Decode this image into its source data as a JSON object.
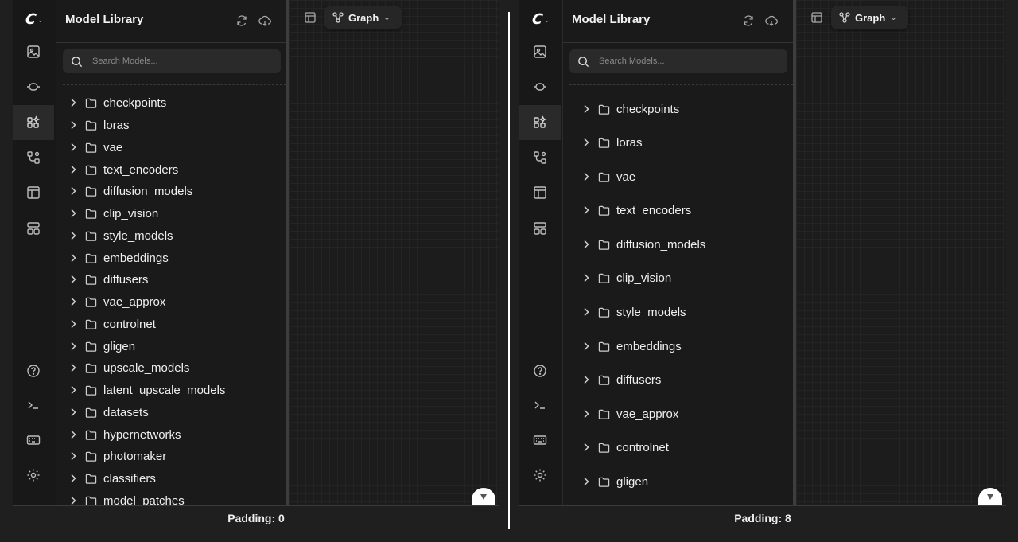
{
  "sidebar": {
    "title": "Model Library",
    "search_placeholder": "Search Models...",
    "folders": [
      "checkpoints",
      "loras",
      "vae",
      "text_encoders",
      "diffusion_models",
      "clip_vision",
      "style_models",
      "embeddings",
      "diffusers",
      "vae_approx",
      "controlnet",
      "gligen",
      "upscale_models",
      "latent_upscale_models",
      "datasets",
      "hypernetworks",
      "photomaker",
      "classifiers",
      "model_patches"
    ]
  },
  "canvas": {
    "view_label": "Graph"
  },
  "examples": [
    {
      "caption": "Padding: 0"
    },
    {
      "caption": "Padding: 8"
    }
  ],
  "icons": {
    "logo": "comfy-logo-icon",
    "rail": [
      "images-icon",
      "link-icon",
      "model-library-icon",
      "workflows-icon",
      "templates-icon",
      "nodes-icon",
      "help-icon",
      "terminal-icon",
      "keyboard-icon",
      "settings-icon"
    ],
    "header": [
      "refresh-icon",
      "download-icon"
    ]
  },
  "colors": {
    "background": "#1f1f1f",
    "sidebar": "#1a1a1a",
    "rail_active": "#2a2a2a",
    "text": "#efefef"
  }
}
